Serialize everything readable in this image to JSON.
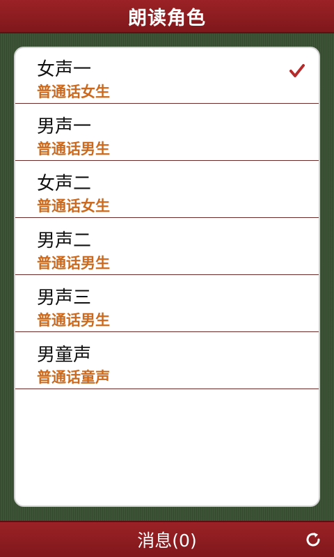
{
  "header": {
    "title": "朗读角色"
  },
  "roles": [
    {
      "name": "女声一",
      "desc": "普通话女生",
      "selected": true
    },
    {
      "name": "男声一",
      "desc": "普通话男生",
      "selected": false
    },
    {
      "name": "女声二",
      "desc": "普通话女生",
      "selected": false
    },
    {
      "name": "男声二",
      "desc": "普通话男生",
      "selected": false
    },
    {
      "name": "男声三",
      "desc": "普通话男生",
      "selected": false
    },
    {
      "name": "男童声",
      "desc": "普通话童声",
      "selected": false
    }
  ],
  "footer": {
    "messages_label": "消息(0)",
    "refresh_icon": "refresh-icon"
  },
  "colors": {
    "bar_red": "#8f1d21",
    "background_green": "#384f31",
    "desc_orange": "#cb6a1e",
    "check_red": "#b52a2a"
  }
}
